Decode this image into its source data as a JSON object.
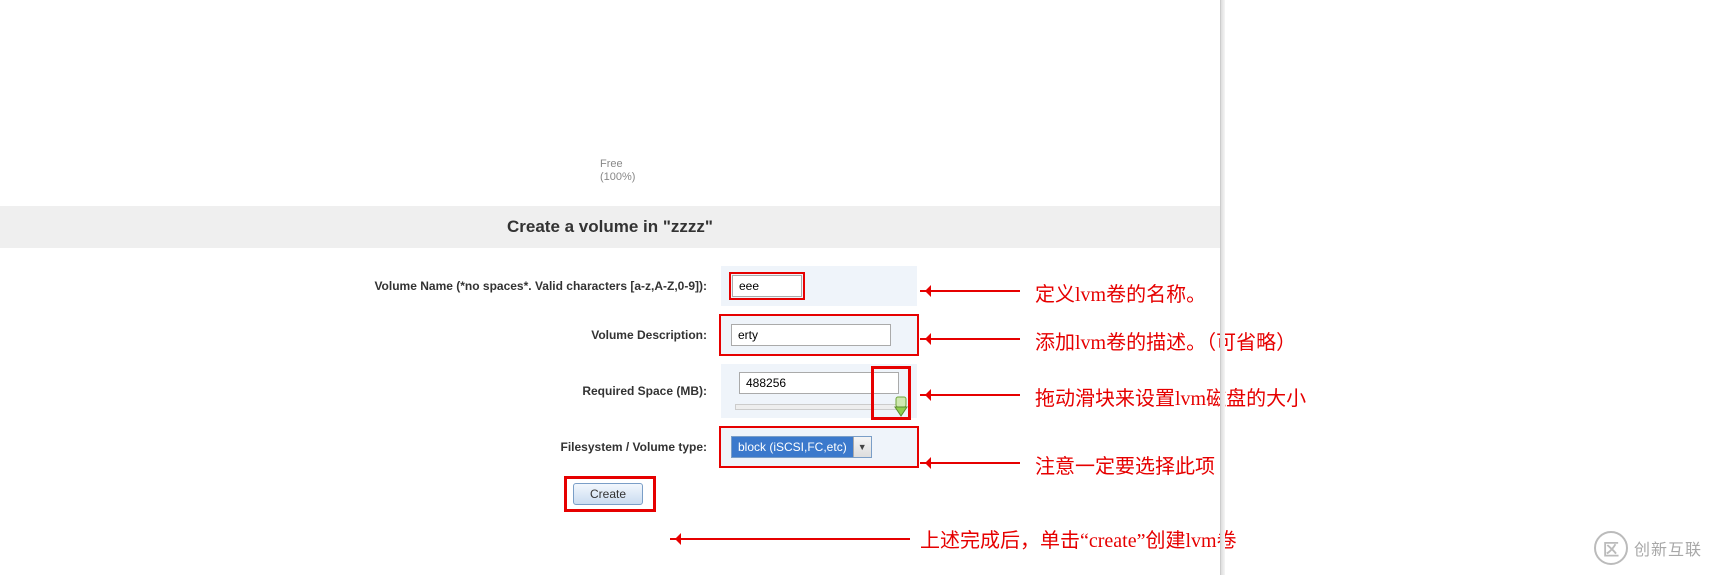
{
  "free": {
    "line1": "Free",
    "line2": "(100%)"
  },
  "title": "Create a volume in \"zzzz\"",
  "form": {
    "name_label": "Volume Name (*no spaces*. Valid characters [a-z,A-Z,0-9]):",
    "name_value": "eee",
    "desc_label": "Volume Description:",
    "desc_value": "erty",
    "space_label": "Required Space (MB):",
    "space_value": "488256",
    "fs_label": "Filesystem / Volume type:",
    "fs_value": "block (iSCSI,FC,etc)",
    "create_label": "Create"
  },
  "anno": {
    "a1": "定义lvm卷的名称。",
    "a2": "添加lvm卷的描述。（可省略）",
    "a3": "拖动滑块来设置lvm磁盘的大小",
    "a4": "注意一定要选择此项",
    "a5": "上述完成后，单击“create”创建lvm卷"
  },
  "watermark": {
    "icon": "区",
    "text": "创新互联"
  }
}
